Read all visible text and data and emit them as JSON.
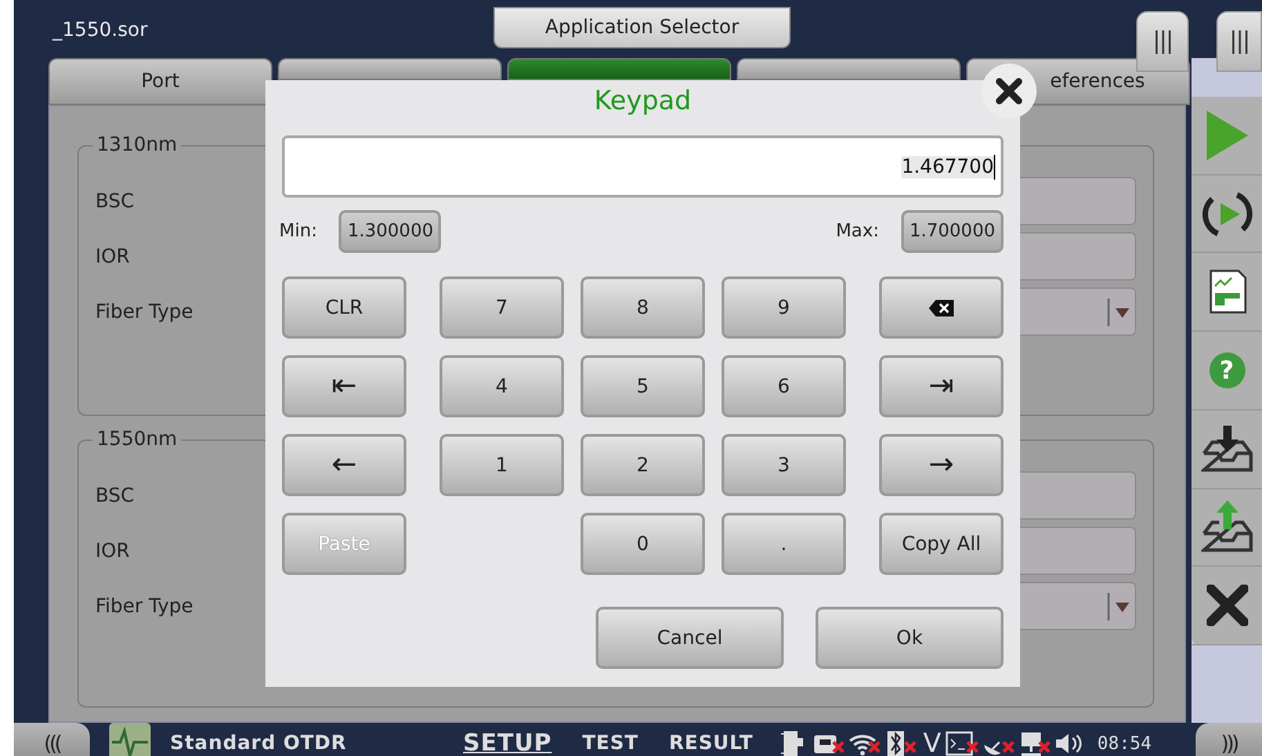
{
  "file_title": "_1550.sor",
  "app_selector": "Application Selector",
  "panel_handles": [
    "|||",
    "|||"
  ],
  "tabs": [
    {
      "label": "Port",
      "selected": false
    },
    {
      "selected": false
    },
    {
      "selected": true
    },
    {
      "selected": false
    },
    {
      "label": "eferences",
      "selected": false
    }
  ],
  "groups": [
    {
      "title": "1310nm",
      "rows": [
        {
          "label": "BSC",
          "kind": "field"
        },
        {
          "label": "IOR",
          "kind": "field"
        },
        {
          "label": "Fiber Type",
          "kind": "dropdown"
        }
      ]
    },
    {
      "title": "1550nm",
      "rows": [
        {
          "label": "BSC",
          "kind": "field"
        },
        {
          "label": "IOR",
          "kind": "field"
        },
        {
          "label": "Fiber Type",
          "kind": "dropdown"
        }
      ]
    }
  ],
  "side_buttons": [
    {
      "kind": "play"
    },
    {
      "kind": "replay"
    },
    {
      "kind": "report"
    },
    {
      "kind": "help",
      "label": "?"
    },
    {
      "kind": "import"
    },
    {
      "kind": "export"
    },
    {
      "kind": "exit"
    }
  ],
  "keypad": {
    "title": "Keypad",
    "value": "1.467700",
    "min_label": "Min:",
    "min": "1.300000",
    "max_label": "Max:",
    "max": "1.700000",
    "keys": [
      {
        "kind": "key",
        "label": "CLR",
        "disabled": false
      },
      {
        "kind": "key",
        "label": "7",
        "disabled": false
      },
      {
        "kind": "key",
        "label": "8",
        "disabled": false
      },
      {
        "kind": "key",
        "label": "9",
        "disabled": false
      },
      {
        "kind": "backspace"
      },
      {
        "kind": "key",
        "label": "⇤",
        "disabled": false
      },
      {
        "kind": "key",
        "label": "4",
        "disabled": false
      },
      {
        "kind": "key",
        "label": "5",
        "disabled": false
      },
      {
        "kind": "key",
        "label": "6",
        "disabled": false
      },
      {
        "kind": "key",
        "label": "⇥",
        "disabled": false
      },
      {
        "kind": "key",
        "label": "←",
        "disabled": false
      },
      {
        "kind": "key",
        "label": "1",
        "disabled": false
      },
      {
        "kind": "key",
        "label": "2",
        "disabled": false
      },
      {
        "kind": "key",
        "label": "3",
        "disabled": false
      },
      {
        "kind": "key",
        "label": "→",
        "disabled": false
      },
      {
        "kind": "key",
        "label": "Paste",
        "disabled": true
      },
      {
        "kind": "blank"
      },
      {
        "kind": "key",
        "label": "0",
        "disabled": false
      },
      {
        "kind": "key",
        "label": ".",
        "disabled": false
      },
      {
        "kind": "key",
        "label": "Copy All",
        "disabled": false
      }
    ],
    "actions": [
      "Cancel",
      "Ok"
    ]
  },
  "bottom_bar": {
    "left_handle": "(((",
    "app_name": "Standard OTDR",
    "modes": [
      {
        "label": "SETUP",
        "selected": true
      },
      {
        "label": "TEST",
        "selected": false
      },
      {
        "label": "RESULT",
        "selected": false
      }
    ],
    "status_icons": [
      {
        "kind": "plug",
        "off": false
      },
      {
        "kind": "card",
        "off": true
      },
      {
        "kind": "wifi",
        "off": true
      },
      {
        "kind": "bluetooth",
        "off": true
      },
      {
        "kind": "letter",
        "label": "V"
      },
      {
        "kind": "terminal",
        "off": true
      },
      {
        "kind": "satellite",
        "off": true
      },
      {
        "kind": "network",
        "off": true
      },
      {
        "kind": "speaker",
        "off": false
      }
    ],
    "time": "08:54",
    "right_handle": ")))"
  }
}
